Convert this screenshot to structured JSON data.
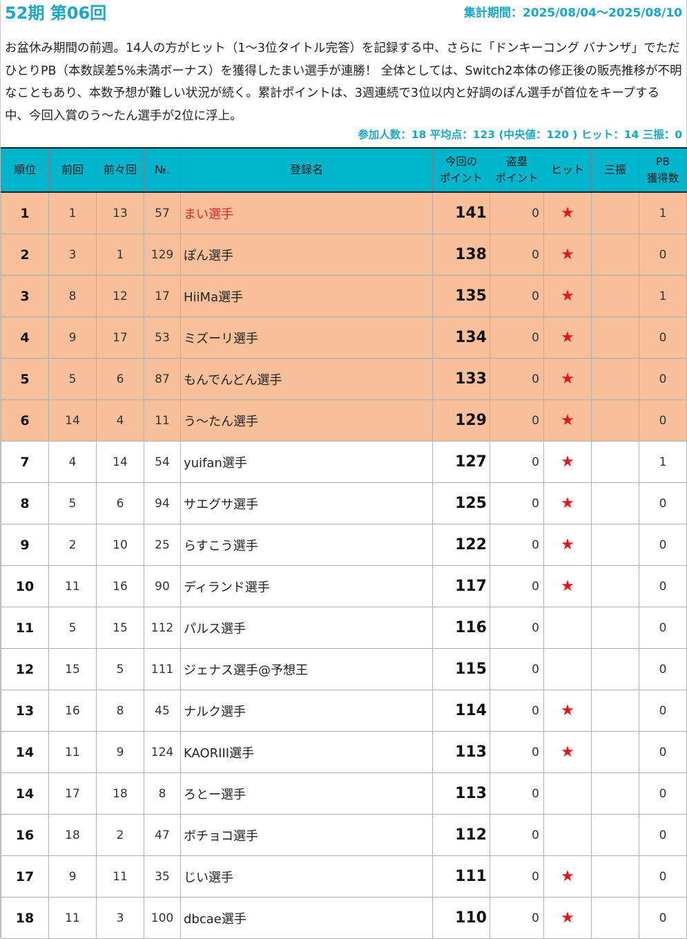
{
  "header": {
    "title": "52期 第06回",
    "period": "集計期間：2025/08/04～2025/08/10"
  },
  "description": "お盆休み期間の前週。14人の方がヒット（1～3位タイトル完答）を記録する中、さらに「ドンキーコング バナンザ」でただひとりPB（本数誤差5%未満ボーナス）を獲得したまい選手が連勝！ 全体としては、Switch2本体の修正後の販売推移が不明なこともあり、本数予想が難しい状況が続く。累計ポイントは、3週連続で3位以内と好調のぽん選手が首位をキープする中、今回入賞のう～たん選手が2位に浮上。",
  "summary": "参加人数：18 平均点：123 (中央値：120 ) ヒット：14 三振：0",
  "columns": {
    "rank": "順位",
    "prev": "前回",
    "prev2": "前々回",
    "no": "№.",
    "name": "登録名",
    "points_1": "今回の",
    "points_2": "ポイント",
    "steal_1": "盗塁",
    "steal_2": "ポイント",
    "hit": "ヒット",
    "strikeout": "三振",
    "pb_1": "PB",
    "pb_2": "獲得数"
  },
  "hit_mark": "★",
  "colors": {
    "accent": "#19a7c8",
    "header_bg": "#00b4cc",
    "top_row_bg": "#f8c09a",
    "hit_star": "#e8141c",
    "highlight_name": "#e8202a"
  },
  "rows": [
    {
      "rank": "1",
      "prev": "1",
      "prev2": "13",
      "no": "57",
      "name": "まい選手",
      "points": "141",
      "steal": "0",
      "hit": true,
      "strikeout": "",
      "pb": "1",
      "top": true,
      "highlight": true
    },
    {
      "rank": "2",
      "prev": "3",
      "prev2": "1",
      "no": "129",
      "name": "ぽん選手",
      "points": "138",
      "steal": "0",
      "hit": true,
      "strikeout": "",
      "pb": "0",
      "top": true
    },
    {
      "rank": "3",
      "prev": "8",
      "prev2": "12",
      "no": "17",
      "name": "HiiMa選手",
      "points": "135",
      "steal": "0",
      "hit": true,
      "strikeout": "",
      "pb": "1",
      "top": true
    },
    {
      "rank": "4",
      "prev": "9",
      "prev2": "17",
      "no": "53",
      "name": "ミズーリ選手",
      "points": "134",
      "steal": "0",
      "hit": true,
      "strikeout": "",
      "pb": "0",
      "top": true
    },
    {
      "rank": "5",
      "prev": "5",
      "prev2": "6",
      "no": "87",
      "name": "もんでんどん選手",
      "points": "133",
      "steal": "0",
      "hit": true,
      "strikeout": "",
      "pb": "0",
      "top": true
    },
    {
      "rank": "6",
      "prev": "14",
      "prev2": "4",
      "no": "11",
      "name": "う～たん選手",
      "points": "129",
      "steal": "0",
      "hit": true,
      "strikeout": "",
      "pb": "0",
      "top": true
    },
    {
      "rank": "7",
      "prev": "4",
      "prev2": "14",
      "no": "54",
      "name": "yuifan選手",
      "points": "127",
      "steal": "0",
      "hit": true,
      "strikeout": "",
      "pb": "1"
    },
    {
      "rank": "8",
      "prev": "5",
      "prev2": "6",
      "no": "94",
      "name": "サエグサ選手",
      "points": "125",
      "steal": "0",
      "hit": true,
      "strikeout": "",
      "pb": "0"
    },
    {
      "rank": "9",
      "prev": "2",
      "prev2": "10",
      "no": "25",
      "name": "らすこう選手",
      "points": "122",
      "steal": "0",
      "hit": true,
      "strikeout": "",
      "pb": "0"
    },
    {
      "rank": "10",
      "prev": "11",
      "prev2": "16",
      "no": "90",
      "name": "ディランド選手",
      "points": "117",
      "steal": "0",
      "hit": true,
      "strikeout": "",
      "pb": "0"
    },
    {
      "rank": "11",
      "prev": "5",
      "prev2": "15",
      "no": "112",
      "name": "パルス選手",
      "points": "116",
      "steal": "0",
      "hit": false,
      "strikeout": "",
      "pb": "0"
    },
    {
      "rank": "12",
      "prev": "15",
      "prev2": "5",
      "no": "111",
      "name": "ジェナス選手@予想王",
      "points": "115",
      "steal": "0",
      "hit": false,
      "strikeout": "",
      "pb": "0"
    },
    {
      "rank": "13",
      "prev": "16",
      "prev2": "8",
      "no": "45",
      "name": "ナルク選手",
      "points": "114",
      "steal": "0",
      "hit": true,
      "strikeout": "",
      "pb": "0"
    },
    {
      "rank": "14",
      "prev": "11",
      "prev2": "9",
      "no": "124",
      "name": "KAORIII選手",
      "points": "113",
      "steal": "0",
      "hit": true,
      "strikeout": "",
      "pb": "0"
    },
    {
      "rank": "14",
      "prev": "17",
      "prev2": "18",
      "no": "8",
      "name": "ろとー選手",
      "points": "113",
      "steal": "0",
      "hit": false,
      "strikeout": "",
      "pb": "0"
    },
    {
      "rank": "16",
      "prev": "18",
      "prev2": "2",
      "no": "47",
      "name": "ボチョコ選手",
      "points": "112",
      "steal": "0",
      "hit": false,
      "strikeout": "",
      "pb": "0"
    },
    {
      "rank": "17",
      "prev": "9",
      "prev2": "11",
      "no": "35",
      "name": "じい選手",
      "points": "111",
      "steal": "0",
      "hit": true,
      "strikeout": "",
      "pb": "0"
    },
    {
      "rank": "18",
      "prev": "11",
      "prev2": "3",
      "no": "100",
      "name": "dbcae選手",
      "points": "110",
      "steal": "0",
      "hit": true,
      "strikeout": "",
      "pb": "0"
    }
  ]
}
